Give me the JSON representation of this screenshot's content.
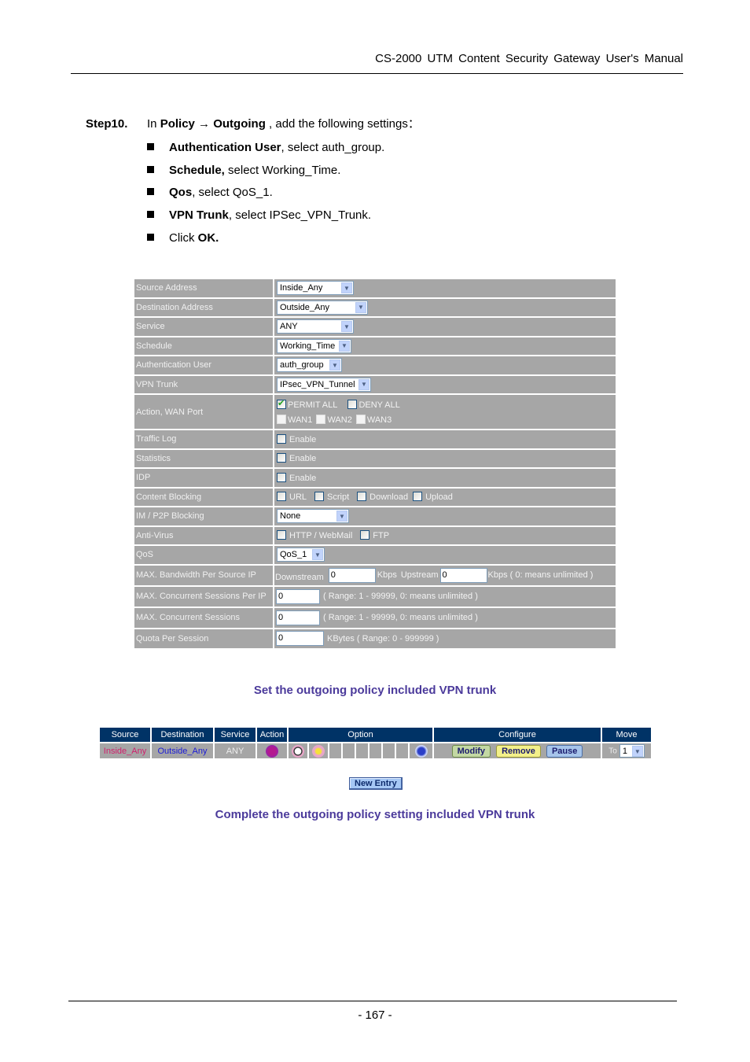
{
  "header": {
    "title": "CS-2000  UTM  Content  Security  Gateway  User's  Manual"
  },
  "step": {
    "number": "Step10.",
    "intro_prefix": "In ",
    "intro_path_1": "Policy",
    "intro_arrow": " → ",
    "intro_path_2": "Outgoing",
    "intro_suffix": " , add the following settings：",
    "bullets": [
      {
        "bold": "Authentication User",
        "text": ", select auth_group."
      },
      {
        "bold": "Schedule,",
        "text": " select Working_Time."
      },
      {
        "bold": "Qos",
        "text": ", select QoS_1."
      },
      {
        "bold": "VPN Trunk",
        "text": ", select IPSec_VPN_Trunk."
      },
      {
        "prefix": "Click ",
        "bold": "OK."
      }
    ]
  },
  "form": {
    "source_address": {
      "label": "Source Address",
      "value": "Inside_Any"
    },
    "destination_address": {
      "label": "Destination Address",
      "value": "Outside_Any"
    },
    "service": {
      "label": "Service",
      "value": "ANY"
    },
    "schedule": {
      "label": "Schedule",
      "value": "Working_Time"
    },
    "authentication_user": {
      "label": "Authentication User",
      "value": "auth_group"
    },
    "vpn_trunk": {
      "label": "VPN Trunk",
      "value": "IPsec_VPN_Tunnel"
    },
    "action_wan": {
      "label": "Action, WAN Port",
      "permit_all": {
        "label": "PERMIT ALL",
        "checked": true
      },
      "deny_all": {
        "label": "DENY ALL",
        "checked": false
      },
      "wan1": {
        "label": "WAN1",
        "checked": false
      },
      "wan2": {
        "label": "WAN2",
        "checked": false
      },
      "wan3": {
        "label": "WAN3",
        "checked": false
      }
    },
    "traffic_log": {
      "label": "Traffic Log",
      "option": "Enable",
      "checked": false
    },
    "statistics": {
      "label": "Statistics",
      "option": "Enable",
      "checked": false
    },
    "idp": {
      "label": "IDP",
      "option": "Enable",
      "checked": false
    },
    "content_blocking": {
      "label": "Content Blocking",
      "options": [
        "URL",
        "Script",
        "Download",
        "Upload"
      ]
    },
    "im_p2p": {
      "label": "IM / P2P Blocking",
      "value": "None"
    },
    "anti_virus": {
      "label": "Anti-Virus",
      "options": [
        "HTTP / WebMail",
        "FTP"
      ]
    },
    "qos": {
      "label": "QoS",
      "value": "QoS_1"
    },
    "max_bw": {
      "label": "MAX. Bandwidth Per Source IP",
      "downstream_label": "Downstream",
      "downstream_value": "0",
      "kbps": "Kbps",
      "upstream_label": "Upstream",
      "upstream_value": "0",
      "note": "Kbps ( 0: means unlimited )"
    },
    "max_sessions_ip": {
      "label": "MAX. Concurrent Sessions Per IP",
      "value": "0",
      "note": "( Range: 1 - 99999, 0: means unlimited )"
    },
    "max_sessions": {
      "label": "MAX. Concurrent Sessions",
      "value": "0",
      "note": "( Range: 1 - 99999, 0: means unlimited )"
    },
    "quota": {
      "label": "Quota Per Session",
      "value": "0",
      "note": "KBytes  ( Range: 0 - 999999 )"
    }
  },
  "caption1": "Set the outgoing policy included VPN trunk",
  "policy_table": {
    "headers": [
      "Source",
      "Destination",
      "Service",
      "Action",
      "Option",
      "Configure",
      "Move"
    ],
    "row": {
      "source": "Inside_Any",
      "destination": "Outside_Any",
      "service": "ANY",
      "action_icon": "vpn-icon",
      "option_icons": [
        "schedule-clock-icon",
        "auth-key-icon",
        "",
        "",
        "",
        "",
        "",
        "",
        "qos-icon"
      ],
      "buttons": {
        "modify": "Modify",
        "remove": "Remove",
        "pause": "Pause"
      },
      "move_to_label": "To",
      "move_to_value": "1"
    },
    "colors": {
      "header_bg": "#003366",
      "source": "#d0206c",
      "destination": "#1a1ad6"
    }
  },
  "new_entry_label": "New Entry",
  "caption2": "Complete the outgoing policy setting included VPN trunk",
  "page_number": "- 167 -"
}
